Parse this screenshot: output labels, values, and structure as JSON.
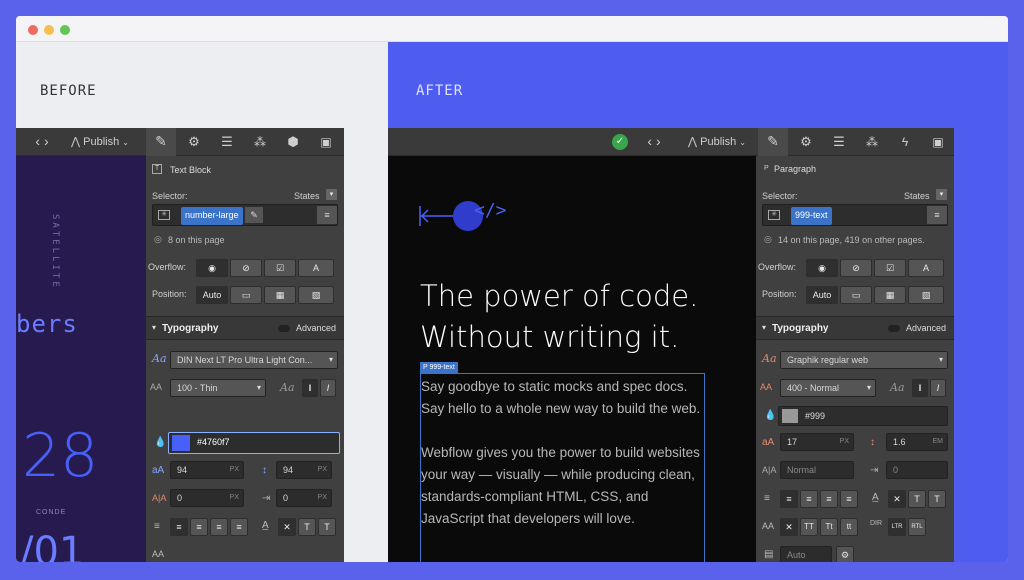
{
  "before_label": "BEFORE",
  "after_label": "AFTER",
  "before": {
    "canvas": {
      "vertical_text": "SATELLITE",
      "big_text_1": "bers",
      "big_number": "28",
      "small_label": "CONDE",
      "bottom_text": "/01"
    },
    "topbar": {
      "code_glyph": "‹ ›",
      "publish_label": "Publish"
    },
    "panel": {
      "element_label": "Text Block",
      "selector_label": "Selector:",
      "states_label": "States",
      "selector_value": "number-large",
      "count_text": "8 on this page",
      "overflow_label": "Overflow:",
      "position_label": "Position:",
      "position_value": "Auto",
      "typography_label": "Typography",
      "advanced_label": "Advanced",
      "font_value": "DIN Next LT Pro Ultra Light Con...",
      "weight_value": "100 - Thin",
      "color_value": "#4760f7",
      "color_swatch": "#4760f7",
      "font_size": "94",
      "line_height": "94",
      "letter_spacing": "0",
      "text_indent": "0",
      "unit_px": "PX",
      "auto_label": "Auto"
    }
  },
  "after": {
    "topbar": {
      "code_glyph": "‹ ›",
      "publish_label": "Publish"
    },
    "canvas": {
      "logo_glyph": "</>",
      "headline_1": "The power of code.",
      "headline_2": "Without writing it.",
      "selection_tag": "999-text",
      "selection_tag_prefix": "P",
      "para_1": "Say goodbye to static mocks and spec docs. Say hello to a whole new way to build the web.",
      "para_2": "Webflow gives you the power to build websites your way — visually — while producing clean, standards-compliant HTML, CSS, and JavaScript that developers will love."
    },
    "panel": {
      "element_prefix": "P",
      "element_label": "Paragraph",
      "selector_label": "Selector:",
      "states_label": "States",
      "selector_value": "999-text",
      "count_text": "14 on this page, 419 on other pages.",
      "overflow_label": "Overflow:",
      "position_label": "Position:",
      "position_value": "Auto",
      "typography_label": "Typography",
      "advanced_label": "Advanced",
      "font_value": "Graphik regular web",
      "weight_value": "400 - Normal",
      "color_value": "#999",
      "color_swatch": "#999999",
      "font_size": "17",
      "line_height": "1.6",
      "letter_spacing": "Normal",
      "text_indent": "0",
      "unit_px": "PX",
      "unit_em": "EM",
      "auto_label": "Auto"
    }
  },
  "colors": {
    "background": "#5a62ec",
    "accent_blue": "#4760f7",
    "selection_blue": "#3b73c9",
    "success_green": "#3aa64c",
    "panel_bg": "#404040"
  }
}
